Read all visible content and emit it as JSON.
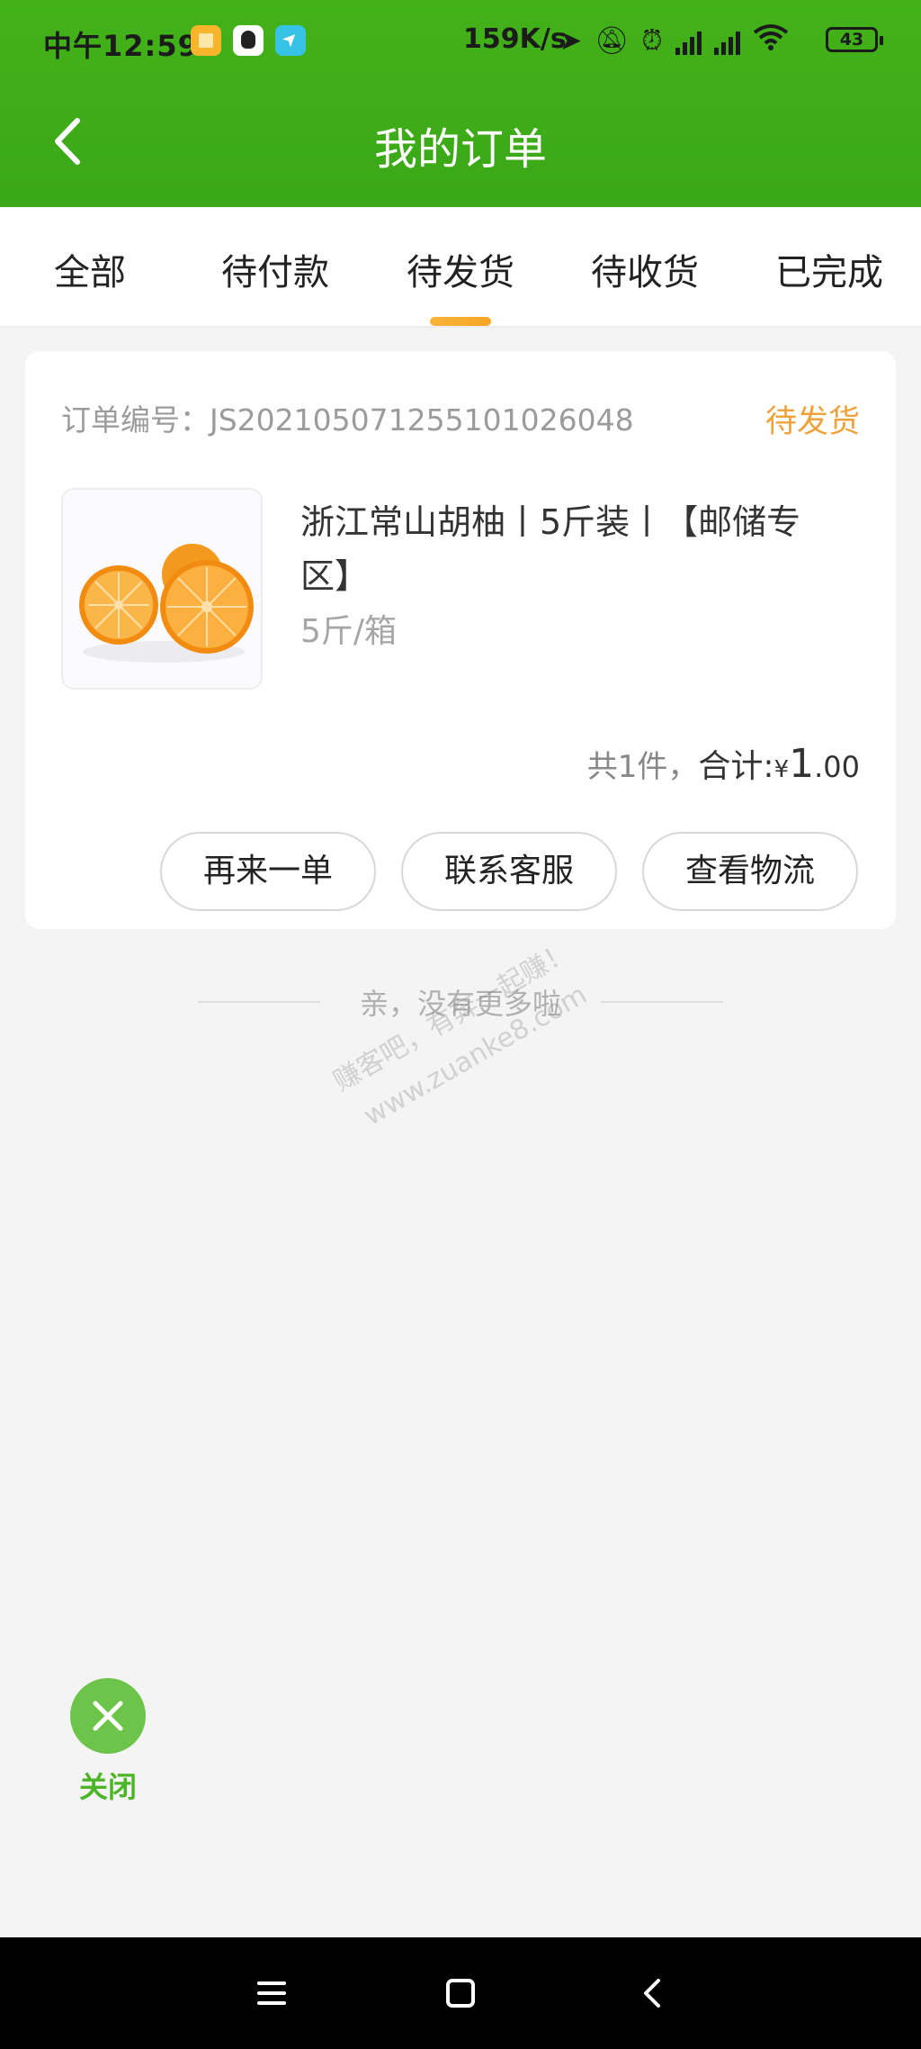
{
  "status_bar": {
    "time": "中午12:59",
    "net_speed": "159K/s",
    "battery": "43"
  },
  "header": {
    "title": "我的订单"
  },
  "tabs": [
    {
      "label": "全部"
    },
    {
      "label": "待付款"
    },
    {
      "label": "待发货",
      "active": true
    },
    {
      "label": "待收货"
    },
    {
      "label": "已完成"
    }
  ],
  "order": {
    "order_no": "订单编号：JS20210507125510102604​8",
    "status": "待发货",
    "product_name": "浙江常山胡柚丨5斤装丨【邮储专区】",
    "spec": "5斤/箱",
    "count_text": "共1件，",
    "total_label": "合计:",
    "currency": "¥",
    "price_int": "1",
    "price_dec": ".00",
    "buttons": {
      "reorder": "再来一单",
      "contact": "联系客服",
      "logistics": "查看物流"
    }
  },
  "list_end": "亲，没有更多啦",
  "watermark": {
    "line1": "赚客吧，有奔一起赚！",
    "line2": "www.zuanke8.com"
  },
  "close": {
    "label": "关闭"
  },
  "colors": {
    "brand_green": "#43b219",
    "status_orange": "#f0a23a",
    "close_green": "#6cc54a"
  }
}
